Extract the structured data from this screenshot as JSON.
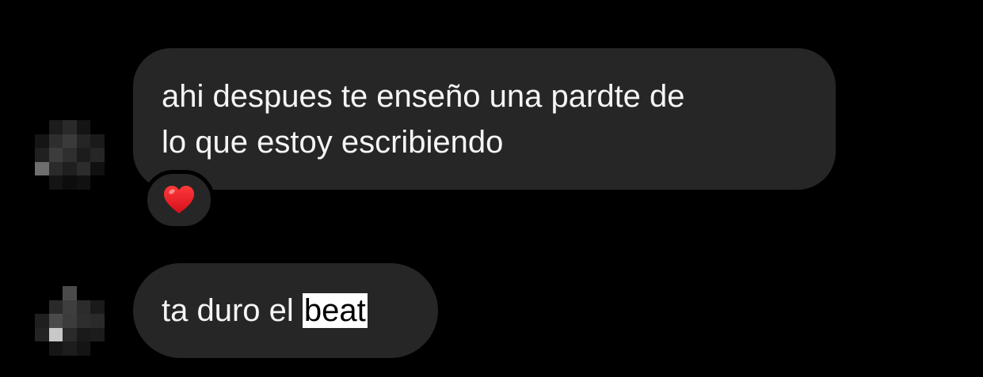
{
  "messages": [
    {
      "lines": [
        "ahi despues te enseño una pardte de",
        "lo que estoy escribiendo"
      ],
      "reaction": "heart",
      "avatar": "pixelated-avatar"
    },
    {
      "text_before": "ta duro el ",
      "selected_text": "beat",
      "avatar": "pixelated-avatar"
    }
  ],
  "colors": {
    "background": "#000000",
    "bubble": "#262626",
    "text": "#f5f5f5",
    "heart": "#e8141f",
    "selection": "#ffffff"
  },
  "avatar_1_pixels": [
    "#000000",
    "#1c1c1c",
    "#2a2a2a",
    "#141414",
    "#000000",
    "#151515",
    "#2e2e2e",
    "#3a3a3a",
    "#252525",
    "#1a1a1a",
    "#202020",
    "#3c3c3c",
    "#2f2f2f",
    "#1c1c1c",
    "#262626",
    "#6e6e6e",
    "#2a2a2a",
    "#1f1f1f",
    "#2c2c2c",
    "#101010",
    "#000000",
    "#141414",
    "#0d0d0d",
    "#111111",
    "#000000"
  ],
  "avatar_2_pixels": [
    "#000000",
    "#000000",
    "#4a4a4a",
    "#000000",
    "#000000",
    "#000000",
    "#2a2a2a",
    "#3e3e3e",
    "#2c2c2c",
    "#1a1a1a",
    "#1f1f1f",
    "#4a4a4a",
    "#3c3c3c",
    "#2e2e2e",
    "#2a2a2a",
    "#242424",
    "#c8c8c8",
    "#2a2a2a",
    "#1a1a1a",
    "#1c1c1c",
    "#000000",
    "#161616",
    "#1d1d1d",
    "#141414",
    "#000000"
  ]
}
